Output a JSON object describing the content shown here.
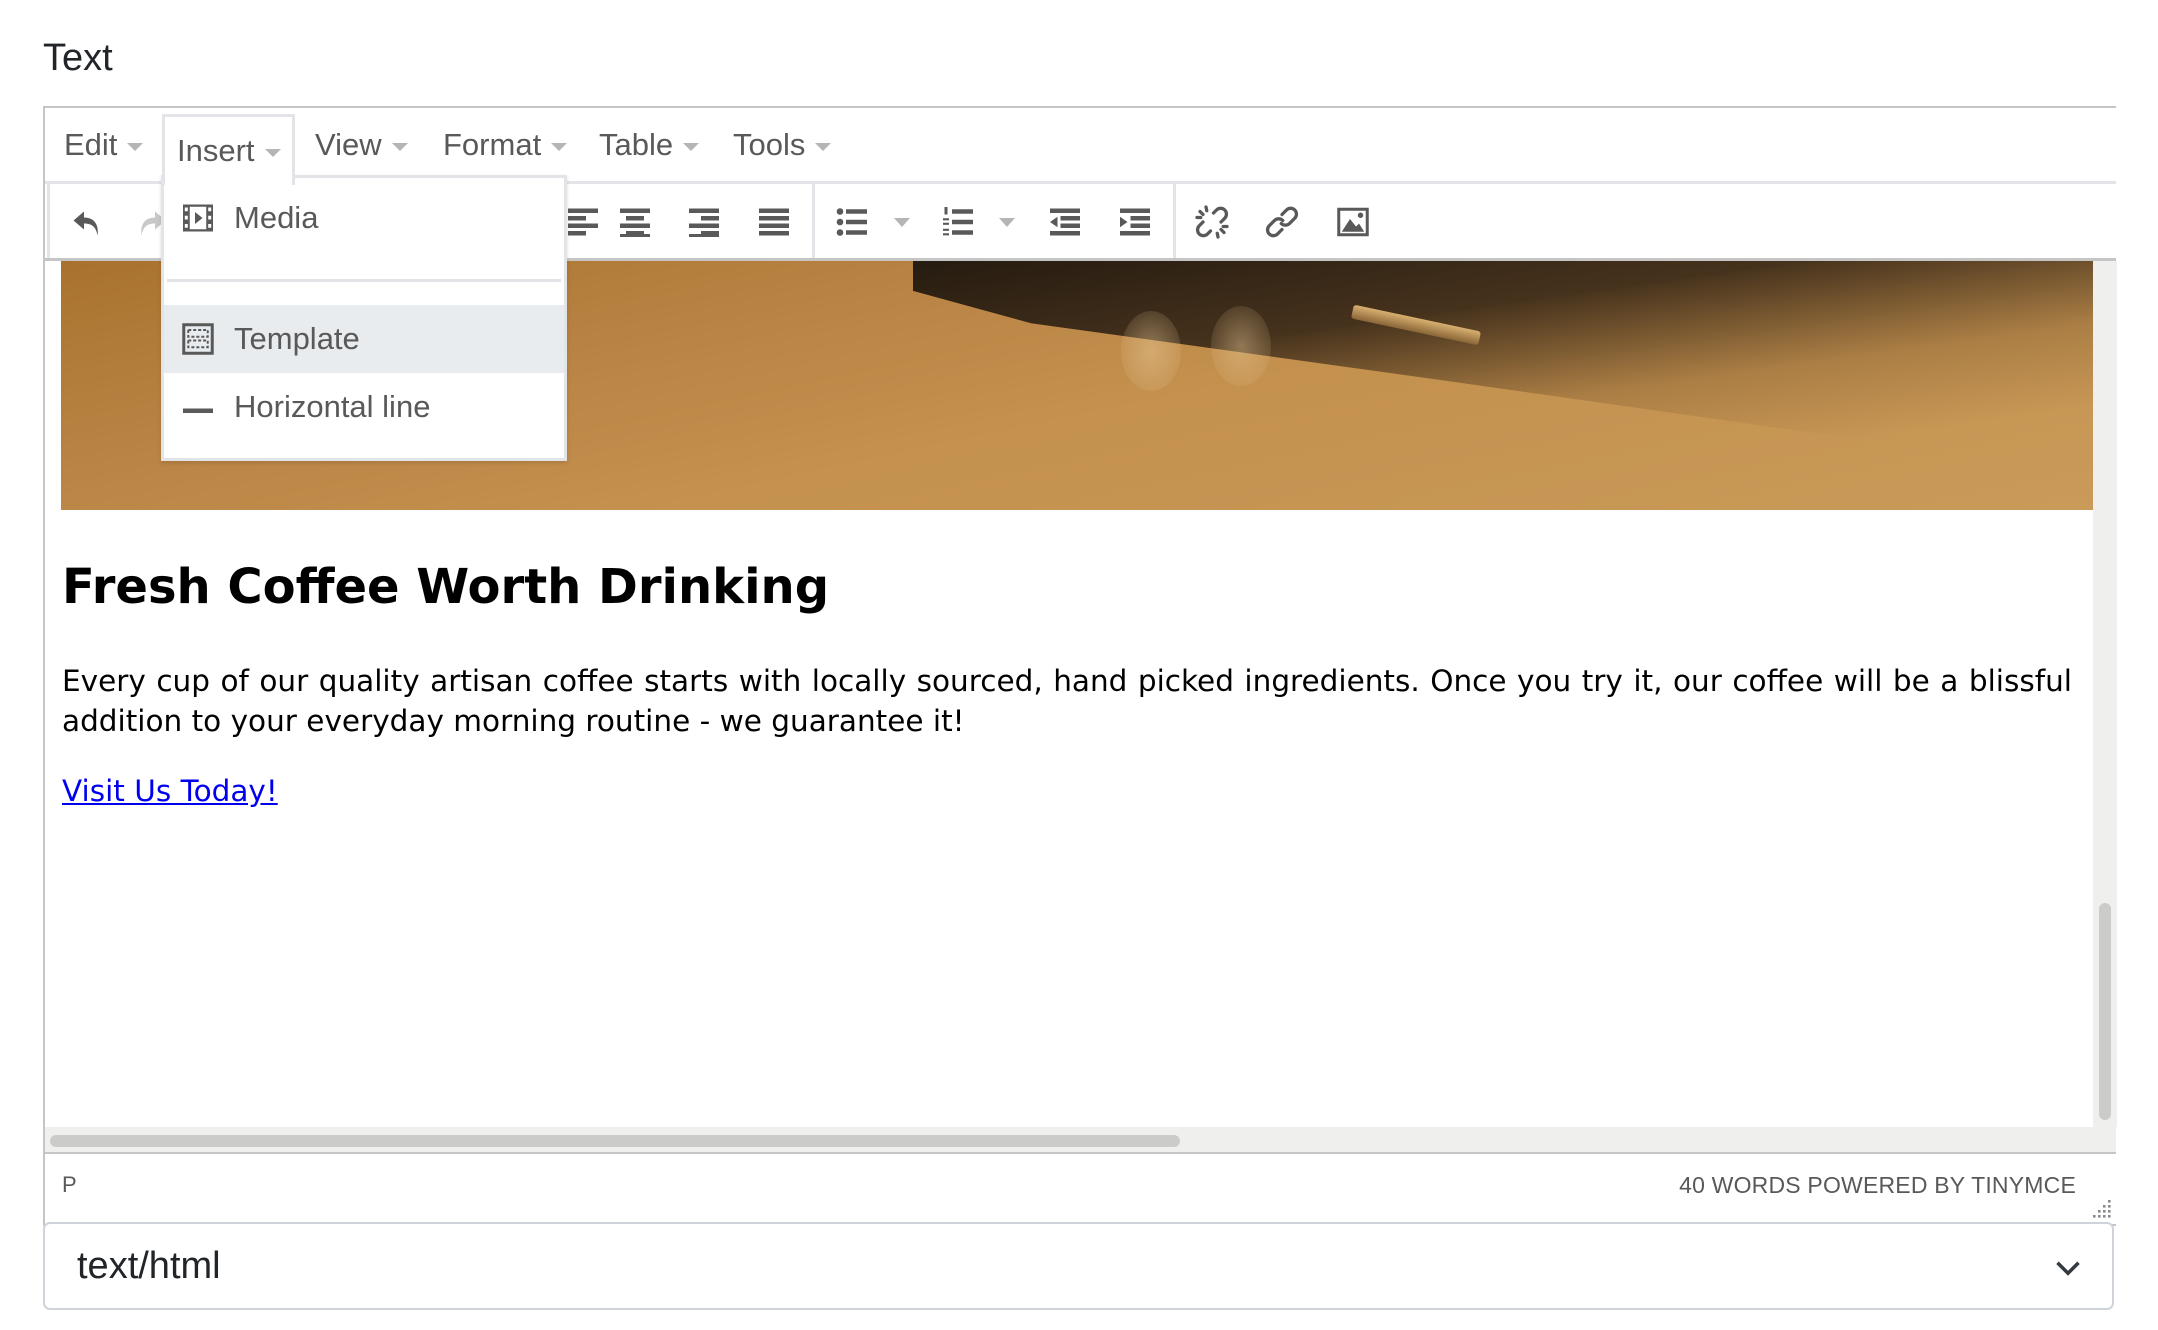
{
  "field": {
    "label": "Text"
  },
  "menubar": {
    "items": [
      {
        "label": "Edit"
      },
      {
        "label": "Insert",
        "active": true
      },
      {
        "label": "View"
      },
      {
        "label": "Format"
      },
      {
        "label": "Table"
      },
      {
        "label": "Tools"
      }
    ]
  },
  "toolbar": {
    "buttons": [
      "undo-icon",
      "redo-icon",
      "align-left-icon",
      "align-center-icon",
      "align-right-icon",
      "align-justify-icon",
      "bullet-list-icon",
      "numbered-list-icon",
      "outdent-icon",
      "indent-icon",
      "unlink-icon",
      "link-icon",
      "image-icon"
    ],
    "redo_disabled": true
  },
  "insert_menu": {
    "items": [
      {
        "label": "Media",
        "icon": "media-icon"
      },
      {
        "label": "Template",
        "icon": "template-icon",
        "highlighted": true
      },
      {
        "label": "Horizontal line",
        "icon": "horizontal-line-icon"
      }
    ]
  },
  "content": {
    "heading": "Fresh Coffee Worth Drinking",
    "paragraph": "Every cup of our quality artisan coffee starts with locally sourced, hand picked ingredients. Once you try it, our coffee will be a blissful addition to your everyday morning routine - we guarantee it!",
    "link_text": "Visit Us Today!",
    "link_color": "#0000ee"
  },
  "statusbar": {
    "path": "P",
    "word_count": "40 WORDS",
    "powered_by": "POWERED BY TINYMCE",
    "right_text": "40 WORDS POWERED BY TINYMCE"
  },
  "format_select": {
    "value": "text/html"
  },
  "colors": {
    "icon": "#595959",
    "icon_disabled": "#c8c8c8",
    "menu_highlight": "#e8ecef",
    "border": "#c5c5c5"
  }
}
